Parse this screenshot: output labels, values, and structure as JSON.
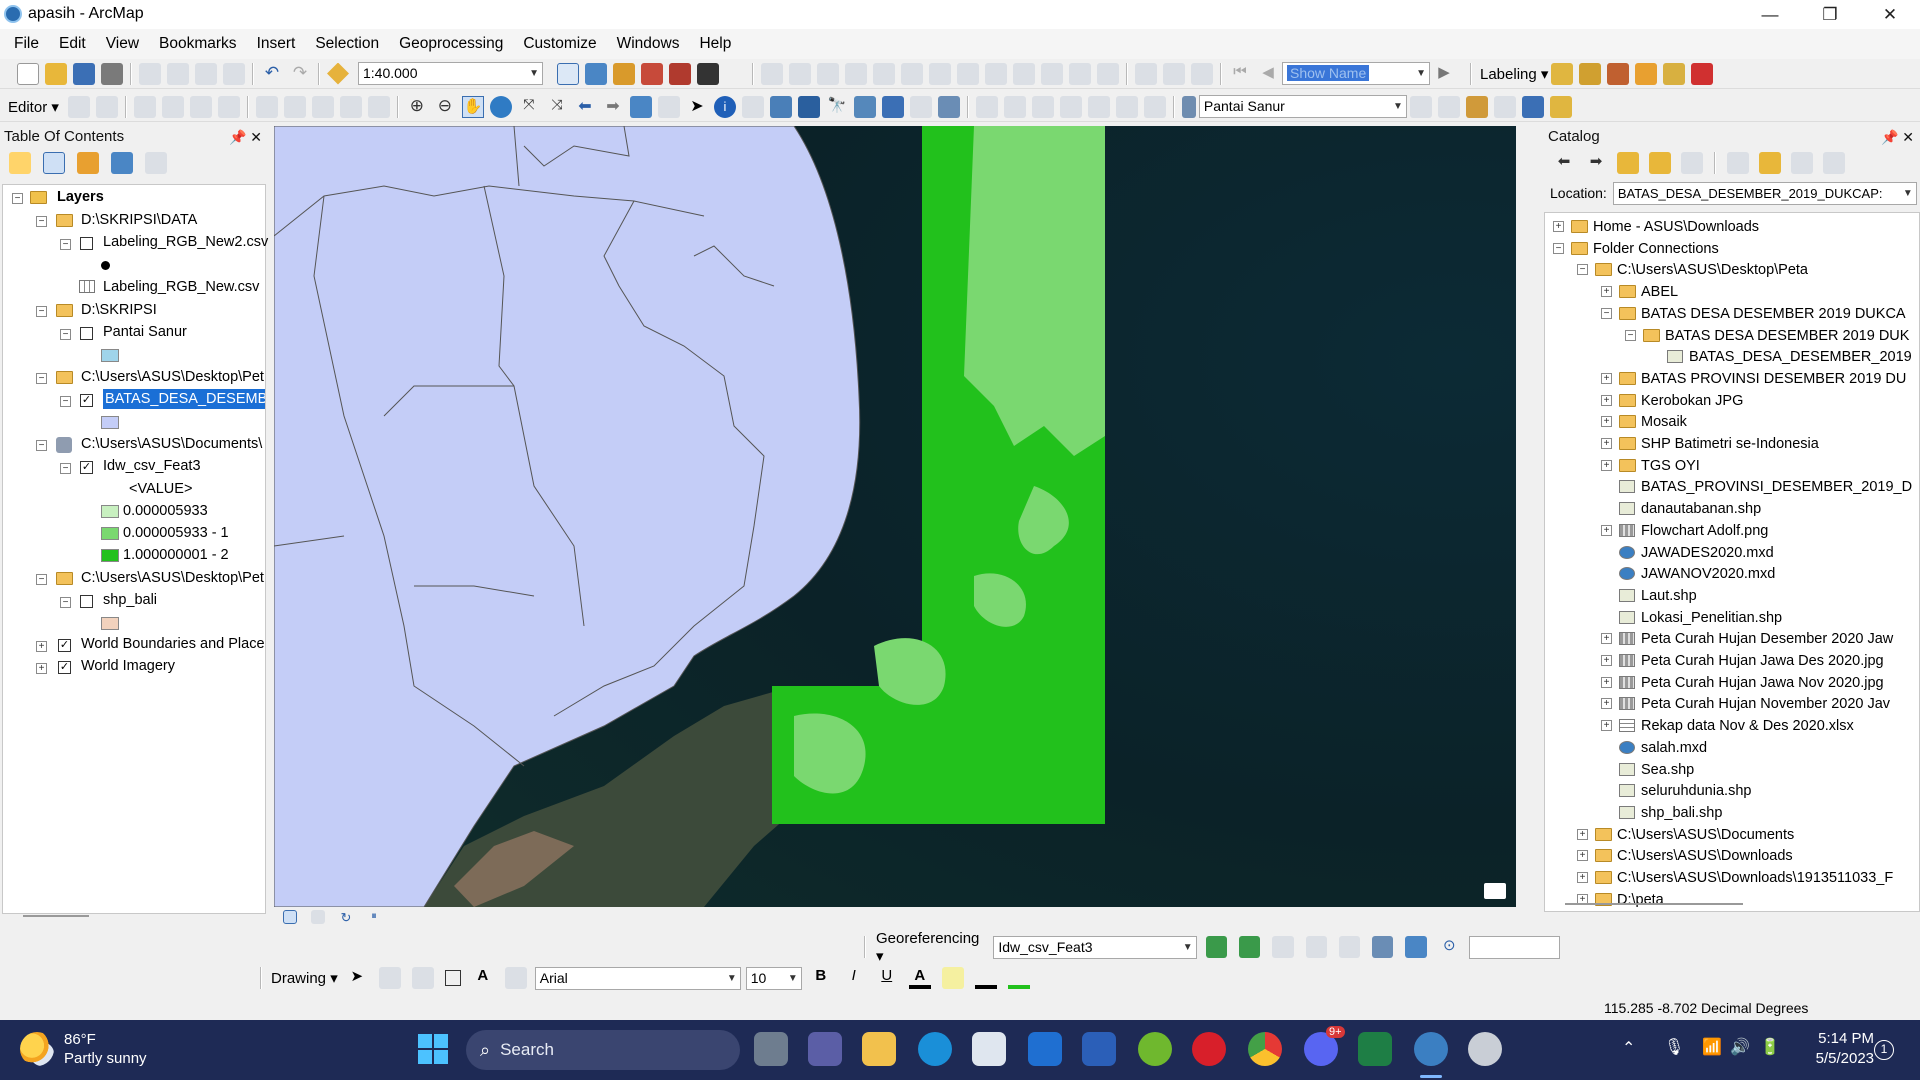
{
  "window": {
    "title": "apasih - ArcMap",
    "minimize": "—",
    "maximize": "❐",
    "close": "✕"
  },
  "menu": [
    "File",
    "Edit",
    "View",
    "Bookmarks",
    "Insert",
    "Selection",
    "Geoprocessing",
    "Customize",
    "Windows",
    "Help"
  ],
  "toolbar": {
    "scale_value": "1:40.000",
    "labeling_label": "Labeling",
    "show_name_value": "Show Name",
    "editor_label": "Editor",
    "layer_combo_value": "Pantai Sanur"
  },
  "toc": {
    "title": "Table Of Contents",
    "layers_label": "Layers",
    "groups": [
      {
        "label": "D:\\SKRIPSI\\DATA"
      },
      {
        "label": "Labeling_RGB_New2.csv"
      },
      {
        "label": "Labeling_RGB_New.csv"
      },
      {
        "label": "D:\\SKRIPSI"
      },
      {
        "label": "Pantai Sanur"
      },
      {
        "label": "C:\\Users\\ASUS\\Desktop\\Pet"
      },
      {
        "label": "BATAS_DESA_DESEMBER"
      },
      {
        "label": "C:\\Users\\ASUS\\Documents\\"
      },
      {
        "label": "Idw_csv_Feat3"
      },
      {
        "label": "<VALUE>"
      },
      {
        "label": "0.000005933"
      },
      {
        "label": "0.000005933 - 1"
      },
      {
        "label": "1.000000001 - 2"
      },
      {
        "label": "C:\\Users\\ASUS\\Desktop\\Pet"
      },
      {
        "label": "shp_bali"
      },
      {
        "label": "World Boundaries and Place"
      },
      {
        "label": "World Imagery"
      }
    ],
    "colors": {
      "pantai": "#9fd4ea",
      "batas": "#c4cdf7",
      "v1": "#c8f0c0",
      "v2": "#7ad870",
      "v3": "#22c11c",
      "bali": "#f2d2bd"
    }
  },
  "catalog": {
    "title": "Catalog",
    "location_label": "Location:",
    "location_value": "BATAS_DESA_DESEMBER_2019_DUKCAP:",
    "items": [
      "Home - ASUS\\Downloads",
      "Folder Connections",
      "C:\\Users\\ASUS\\Desktop\\Peta",
      "ABEL",
      "BATAS DESA DESEMBER 2019 DUKCA",
      "BATAS DESA DESEMBER 2019 DUK",
      "BATAS_DESA_DESEMBER_2019",
      "BATAS PROVINSI DESEMBER 2019 DU",
      "Kerobokan JPG",
      "Mosaik",
      "SHP Batimetri se-Indonesia",
      "TGS OYI",
      "BATAS_PROVINSI_DESEMBER_2019_D",
      "danautabanan.shp",
      "Flowchart Adolf.png",
      "JAWADES2020.mxd",
      "JAWANOV2020.mxd",
      "Laut.shp",
      "Lokasi_Penelitian.shp",
      "Peta Curah Hujan Desember 2020 Jaw",
      "Peta Curah Hujan Jawa Des 2020.jpg",
      "Peta Curah Hujan Jawa Nov 2020.jpg",
      "Peta Curah Hujan November 2020 Jav",
      "Rekap data Nov & Des 2020.xlsx",
      "salah.mxd",
      "Sea.shp",
      "seluruhdunia.shp",
      "shp_bali.shp",
      "C:\\Users\\ASUS\\Documents",
      "C:\\Users\\ASUS\\Downloads",
      "C:\\Users\\ASUS\\Downloads\\1913511033_F",
      "D:\\peta"
    ]
  },
  "georef": {
    "label": "Georeferencing",
    "layer_value": "Idw_csv_Feat3"
  },
  "drawing": {
    "label": "Drawing",
    "font_value": "Arial",
    "size_value": "10",
    "bold": "B",
    "italic": "I",
    "underline": "U",
    "font_color_glyph": "A"
  },
  "status": {
    "coords": "115.285  -8.702 Decimal Degrees"
  },
  "taskbar": {
    "weather_temp": "86°F",
    "weather_desc": "Partly sunny",
    "search_label": "Search",
    "time": "5:14 PM",
    "date": "5/5/2023",
    "discord_badge": "9+",
    "notif_count": "1"
  }
}
